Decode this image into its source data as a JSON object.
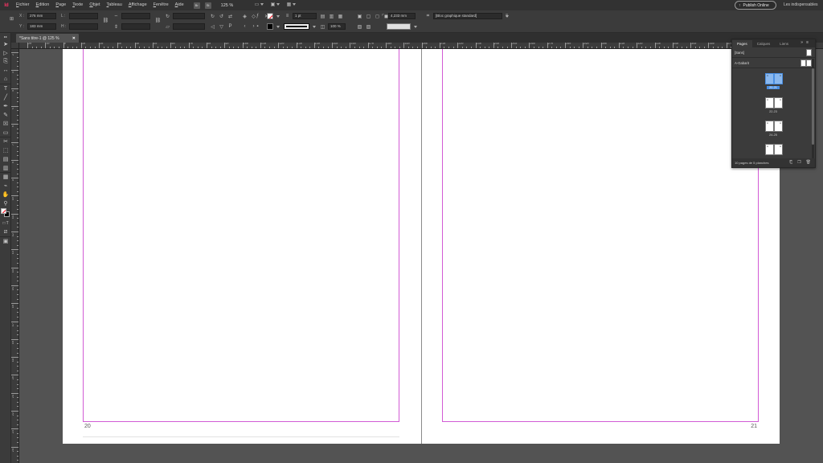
{
  "menubar": {
    "logo": "Id",
    "items": [
      "Fichier",
      "Edition",
      "Page",
      "Texte",
      "Objet",
      "Tableau",
      "Affichage",
      "Fenêtre",
      "Aide"
    ],
    "mode_box1": "Br",
    "mode_box2": "St",
    "zoom": "125 %",
    "publish_label": "Publish Online",
    "workspace": "Les indispensables"
  },
  "control": {
    "x_label": "X :",
    "x_value": "276 mm",
    "y_label": "Y :",
    "y_value": "183 mm",
    "w_label": "L :",
    "h_label": "H :",
    "stroke_weight": "1 pt",
    "opacity": "100 %",
    "size_value": "4,233 mm",
    "object_style": "[Bloc graphique standard]"
  },
  "document": {
    "tab_title": "*Sans titre-1 @ 125 %",
    "folio_left": "20",
    "folio_right": "21"
  },
  "ruler": {
    "top_labels": [
      "20",
      "10",
      "0",
      "10",
      "20",
      "30",
      "40",
      "50",
      "60",
      "70",
      "80",
      "90",
      "100",
      "110",
      "120",
      "130",
      "140",
      "150",
      "160",
      "170",
      "180",
      "190",
      "200",
      "210",
      "220",
      "230",
      "240",
      "250",
      "260",
      "270",
      "280",
      "290",
      "300",
      "310",
      "320",
      "330",
      "340",
      "350",
      "360",
      "370",
      "380",
      "390"
    ],
    "left_labels": [
      "2",
      "3",
      "4",
      "5",
      "6",
      "7",
      "8",
      "9",
      "10",
      "11",
      "12",
      "13",
      "14",
      "15",
      "16",
      "17",
      "18",
      "19",
      "20",
      "21",
      "22",
      "23",
      "24",
      "25"
    ]
  },
  "pages_panel": {
    "tabs": [
      "Pages",
      "Calques",
      "Liens"
    ],
    "none_master": "[Sans]",
    "a_master": "A-Gabarit",
    "spreads": [
      {
        "label": "20-21",
        "selected": true
      },
      {
        "label": "22-23",
        "selected": false
      },
      {
        "label": "24-25",
        "selected": false
      },
      {
        "label": "",
        "selected": false
      }
    ],
    "footer": "10 pages de 5 planches"
  }
}
